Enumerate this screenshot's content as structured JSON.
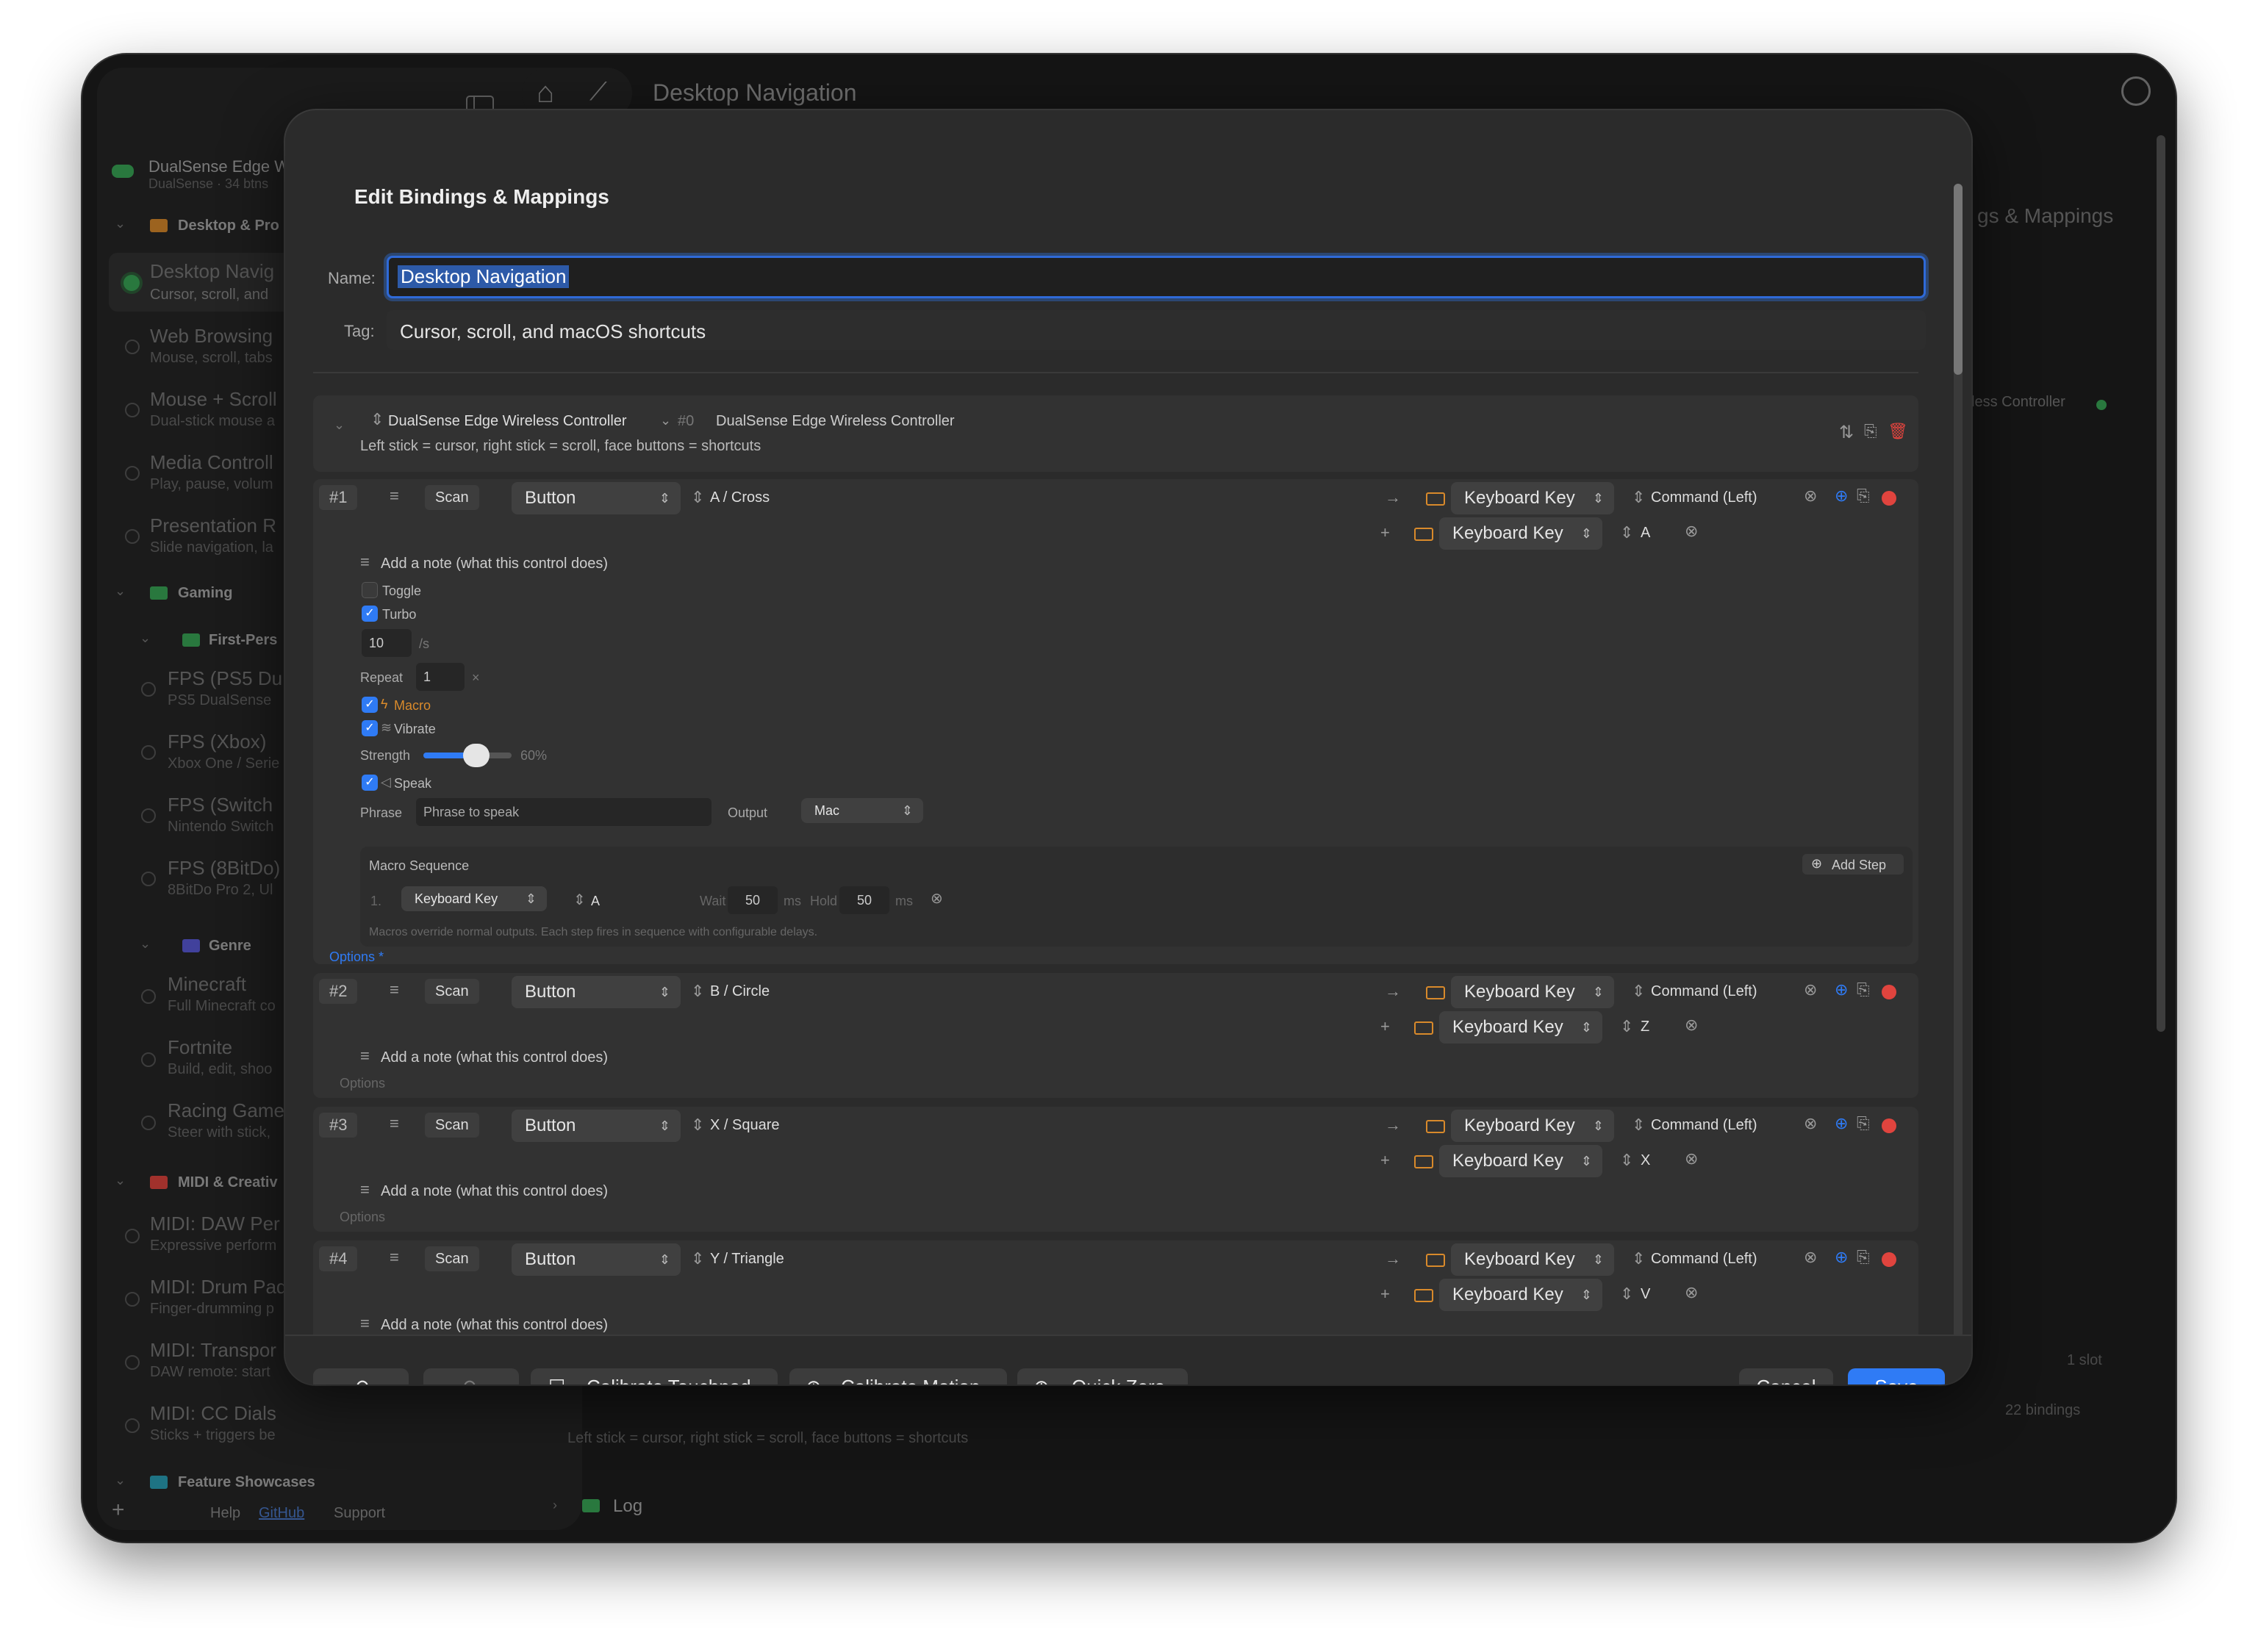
{
  "window": {
    "title": "Desktop Navigation",
    "bg_title": "gs & Mappings",
    "bg_controller": "less Controller",
    "bg_slots": "1 slot",
    "bg_bindings": "22 bindings",
    "bg_desc": "Left stick = cursor, right stick = scroll, face buttons = shortcuts",
    "log_label": "Log"
  },
  "sidebar": {
    "device_name": "DualSense Edge Wireless...",
    "device_sub": "DualSense · 34 btns",
    "groups": {
      "desktop": "Desktop & Pro",
      "gaming": "Gaming",
      "fps": "First-Pers",
      "genre": "Genre",
      "midi": "MIDI & Creativ",
      "features": "Feature Showcases"
    },
    "profiles": [
      {
        "title": "Desktop Navig",
        "sub": "Cursor, scroll, and"
      },
      {
        "title": "Web Browsing",
        "sub": "Mouse, scroll, tabs"
      },
      {
        "title": "Mouse + Scroll",
        "sub": "Dual-stick mouse a"
      },
      {
        "title": "Media Controll",
        "sub": "Play, pause, volum"
      },
      {
        "title": "Presentation R",
        "sub": "Slide navigation, la"
      },
      {
        "title": "FPS (PS5 Du",
        "sub": "PS5 DualSense"
      },
      {
        "title": "FPS (Xbox)",
        "sub": "Xbox One / Serie"
      },
      {
        "title": "FPS (Switch",
        "sub": "Nintendo Switch"
      },
      {
        "title": "FPS (8BitDo)",
        "sub": "8BitDo Pro 2, Ul"
      },
      {
        "title": "Minecraft",
        "sub": "Full Minecraft co"
      },
      {
        "title": "Fortnite",
        "sub": "Build, edit, shoo"
      },
      {
        "title": "Racing Game",
        "sub": "Steer with stick, "
      },
      {
        "title": "MIDI: DAW Per",
        "sub": "Expressive perform"
      },
      {
        "title": "MIDI: Drum Pad",
        "sub": "Finger-drumming p"
      },
      {
        "title": "MIDI: Transpor",
        "sub": "DAW remote: start"
      },
      {
        "title": "MIDI: CC Dials",
        "sub": "Sticks + triggers be"
      }
    ],
    "footer": {
      "help": "Help",
      "github": "GitHub",
      "support": "Support"
    }
  },
  "dialog": {
    "title": "Edit Bindings & Mappings",
    "name_label": "Name:",
    "name_value": "Desktop Navigation",
    "tag_label": "Tag:",
    "tag_value": "Cursor, scroll, and macOS shortcuts",
    "controller": {
      "name": "DualSense Edge Wireless Controller",
      "index": "#0",
      "full_name": "DualSense Edge Wireless Controller",
      "desc": "Left stick = cursor, right stick = scroll, face buttons = shortcuts"
    },
    "bindings": [
      {
        "num": "#1",
        "scan": "Scan",
        "type": "Button",
        "input": "A / Cross",
        "out1_type": "Keyboard Key",
        "out1_key": "Command (Left)",
        "out2_type": "Keyboard Key",
        "out2_key": "A",
        "note": "Add a note (what this control does)",
        "options": "Options *"
      },
      {
        "num": "#2",
        "scan": "Scan",
        "type": "Button",
        "input": "B / Circle",
        "out1_type": "Keyboard Key",
        "out1_key": "Command (Left)",
        "out2_type": "Keyboard Key",
        "out2_key": "Z",
        "note": "Add a note (what this control does)",
        "options": "Options"
      },
      {
        "num": "#3",
        "scan": "Scan",
        "type": "Button",
        "input": "X / Square",
        "out1_type": "Keyboard Key",
        "out1_key": "Command (Left)",
        "out2_type": "Keyboard Key",
        "out2_key": "X",
        "note": "Add a note (what this control does)",
        "options": "Options"
      },
      {
        "num": "#4",
        "scan": "Scan",
        "type": "Button",
        "input": "Y / Triangle",
        "out1_type": "Keyboard Key",
        "out1_key": "Command (Left)",
        "out2_type": "Keyboard Key",
        "out2_key": "V",
        "note": "Add a note (what this control does)"
      }
    ],
    "options1": {
      "toggle": "Toggle",
      "toggle_checked": false,
      "turbo": "Turbo",
      "turbo_checked": true,
      "turbo_rate": "10",
      "turbo_unit": "/s",
      "repeat_label": "Repeat",
      "repeat_value": "1",
      "repeat_unit": "×",
      "macro": "Macro",
      "macro_checked": true,
      "vibrate": "Vibrate",
      "vibrate_checked": true,
      "strength_label": "Strength",
      "strength_value": "60%",
      "strength_fraction": 0.6,
      "speak": "Speak",
      "speak_checked": true,
      "phrase_label": "Phrase",
      "phrase_placeholder": "Phrase to speak",
      "output_label": "Output",
      "output_value": "Mac"
    },
    "macro": {
      "title": "Macro Sequence",
      "add_step": "Add Step",
      "step_num": "1.",
      "step_type": "Keyboard Key",
      "step_key": "A",
      "wait_label": "Wait",
      "wait_value": "50",
      "hold_label": "Hold",
      "hold_value": "50",
      "unit": "ms",
      "footnote": "Macros override normal outputs. Each step fires in sequence with configurable delays."
    },
    "footer": {
      "calibrate_touchpad": "Calibrate Touchpad",
      "calibrate_motion": "Calibrate Motion",
      "quick_zero": "Quick Zero",
      "cancel": "Cancel",
      "save": "Save"
    }
  },
  "colors": {
    "accent": "#2f7bf5",
    "danger": "#e0443e",
    "orange": "#d98a2b",
    "green": "#3aa757"
  }
}
